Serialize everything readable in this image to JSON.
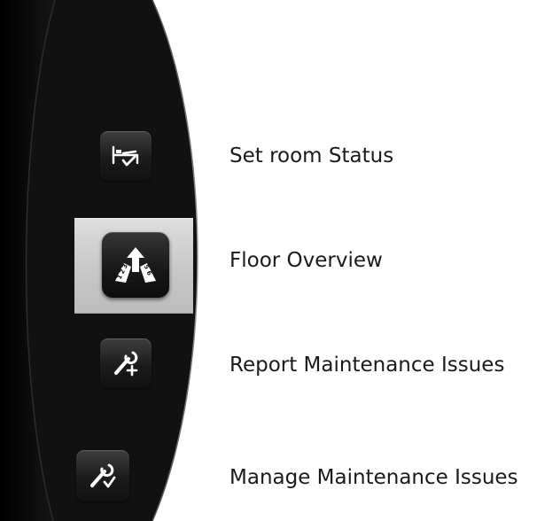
{
  "menu": {
    "items": [
      {
        "label": "Set room Status",
        "icon": "bed-check-icon"
      },
      {
        "label": "Floor Overview",
        "icon": "floors-arrow-icon"
      },
      {
        "label": "Report Maintenance Issues",
        "icon": "wrench-plus-icon"
      },
      {
        "label": "Manage Maintenance Issues",
        "icon": "wrench-check-icon"
      }
    ],
    "selected_index": 1
  },
  "floor_icon_numbers": [
    "1",
    "2",
    "3",
    "5",
    "6"
  ],
  "colors": {
    "panel_background": "#0f0f0f",
    "selected_highlight": "#cfcfcf",
    "button_background": "#1b1b1b",
    "icon": "#ffffff",
    "label_text": "#1a1a1a"
  }
}
